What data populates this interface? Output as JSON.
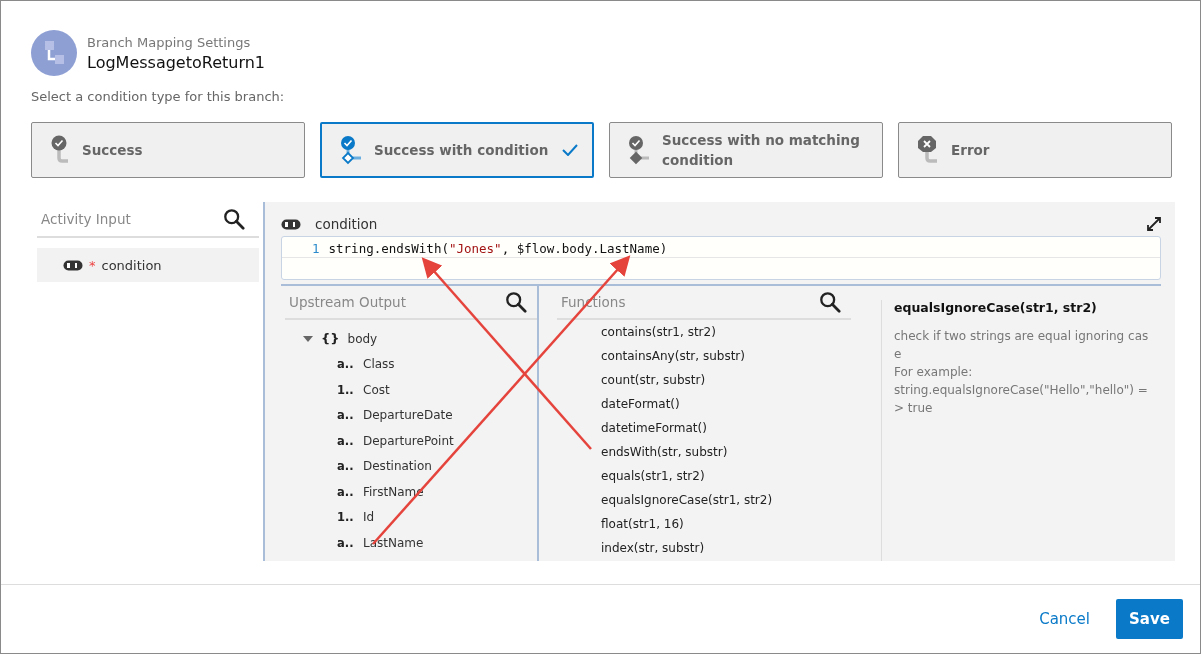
{
  "header": {
    "subtitle": "Branch Mapping Settings",
    "title": "LogMessagetoReturn1"
  },
  "prompt": "Select a condition type for this branch:",
  "condition_types": [
    {
      "label": "Success",
      "kind": "success",
      "selected": false
    },
    {
      "label": "Success with condition",
      "kind": "condition",
      "selected": true
    },
    {
      "label": "Success with no matching condition",
      "kind": "nomatch",
      "selected": false
    },
    {
      "label": "Error",
      "kind": "error",
      "selected": false
    }
  ],
  "activity_input": {
    "title": "Activity Input",
    "items": [
      {
        "label": "condition",
        "required": "*",
        "selected": true
      }
    ]
  },
  "editor": {
    "label": "condition",
    "lines": [
      {
        "number": "1",
        "parts": [
          {
            "kind": "plain",
            "text": "string.endsWith("
          },
          {
            "kind": "string",
            "text": "\"Jones\""
          },
          {
            "kind": "plain",
            "text": ", $flow.body.LastName)"
          }
        ]
      }
    ]
  },
  "upstream": {
    "title": "Upstream Output",
    "tree": [
      {
        "label": "body",
        "glyph": "{}",
        "expanded": true,
        "children": [
          {
            "type": "a..",
            "label": "Class"
          },
          {
            "type": "1..",
            "label": "Cost"
          },
          {
            "type": "a..",
            "label": "DepartureDate"
          },
          {
            "type": "a..",
            "label": "DeparturePoint"
          },
          {
            "type": "a..",
            "label": "Destination"
          },
          {
            "type": "a..",
            "label": "FirstName"
          },
          {
            "type": "1..",
            "label": "Id"
          },
          {
            "type": "a..",
            "label": "LastName"
          }
        ]
      }
    ]
  },
  "functions": {
    "title": "Functions",
    "items": [
      "contains(str1, str2)",
      "containsAny(str, substr)",
      "count(str, substr)",
      "dateFormat()",
      "datetimeFormat()",
      "endsWith(str, substr)",
      "equals(str1, str2)",
      "equalsIgnoreCase(str1, str2)",
      "float(str1, 16)",
      "index(str, substr)"
    ]
  },
  "details": {
    "title": "equalsIgnoreCase(str1, str2)",
    "description": "check if two strings are equal ignoring case",
    "example_label": "For example:",
    "example": "string.equalsIgnoreCase(\"Hello\",\"hello\") => true"
  },
  "buttons": [
    {
      "label": "Cancel",
      "kind": "link"
    },
    {
      "label": "Save",
      "kind": "primary"
    }
  ]
}
